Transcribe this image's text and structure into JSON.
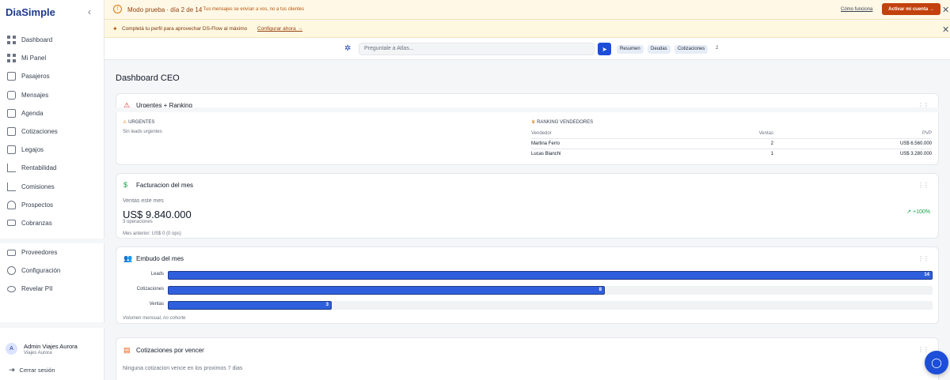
{
  "sidebar": {
    "brand": "DiaSimple",
    "collapse_icon": "chevron-left-icon",
    "items": [
      {
        "label": "Dashboard",
        "icon": "grid-icon"
      },
      {
        "label": "Mi Panel",
        "icon": "grid-icon"
      },
      {
        "label": "Pasajeros",
        "icon": "passport-icon"
      },
      {
        "label": "Mensajes",
        "icon": "inbox-icon"
      },
      {
        "label": "Agenda",
        "icon": "calendar-icon"
      },
      {
        "label": "Cotizaciones",
        "icon": "file-text-icon"
      },
      {
        "label": "Legajos",
        "icon": "folder-icon"
      },
      {
        "label": "Rentabilidad",
        "icon": "bar-chart-icon"
      },
      {
        "label": "Comisiones",
        "icon": "bar-chart-icon"
      },
      {
        "label": "Prospectos",
        "icon": "users-icon"
      },
      {
        "label": "Cobranzas",
        "icon": "credit-card-icon"
      },
      {
        "label": "Proveedores",
        "icon": "truck-icon"
      },
      {
        "label": "Configuración",
        "icon": "gear-icon"
      },
      {
        "label": "Revelar PII",
        "icon": "eye-icon"
      }
    ],
    "user": {
      "initial": "A",
      "name": "Admin Viajes Aurora",
      "org": "Viajes Aurora"
    },
    "logout_label": "Cerrar sesión"
  },
  "banner_trial": {
    "title": "Modo prueba · día 2 de 14",
    "subtitle": "· Tus mensajes se envían a vos, no a tus clientes",
    "link": "Cómo funciona",
    "button": "Activar mi cuenta →"
  },
  "banner_profile": {
    "text": "Completá tu perfil para aprovechar DS-Flow al máximo",
    "link": "Configurar ahora →"
  },
  "atlas": {
    "placeholder": "Preguntale a Atlas...",
    "chips": [
      "Resumen",
      "Deudas",
      "Cotizaciones"
    ],
    "chip_count": "2"
  },
  "page_title": "Dashboard CEO",
  "card_urgent": {
    "title": "Urgentes + Ranking",
    "urgent_label": "URGENTES",
    "urgent_empty": "Sin leads urgentes",
    "ranking_label": "RANKING VENDEDORES",
    "columns": [
      "Vendedor",
      "Ventas",
      "PVP"
    ],
    "rows": [
      {
        "name": "Martina Ferro",
        "sales": "2",
        "pvp": "US$ 6.560.000"
      },
      {
        "name": "Lucas Bianchi",
        "sales": "1",
        "pvp": "US$ 3.280.000"
      }
    ]
  },
  "card_billing": {
    "title": "Facturacion del mes",
    "label": "Ventas este mes",
    "amount": "US$ 9.840.000",
    "ops": "3 operaciones",
    "previous": "Mes anterior: US$ 0 (0 ops)",
    "trend": "+100%"
  },
  "card_funnel": {
    "title": "Embudo del mes",
    "note": "Volumen mensual, no cohorte",
    "max": 14,
    "stages": [
      {
        "label": "Leads",
        "value": 14,
        "display": "14"
      },
      {
        "label": "Cotizaciones",
        "value": 8,
        "display": "8"
      },
      {
        "label": "Ventas",
        "value": 3,
        "display": "3"
      }
    ]
  },
  "card_quotes": {
    "title": "Cotizaciones por vencer",
    "empty": "Ninguna cotizacion vence en los proximos 7 dias"
  },
  "colors": {
    "brand": "#1e3a8a",
    "accent": "#1d4ed8",
    "cta": "#c2410c",
    "positive": "#16a34a"
  }
}
